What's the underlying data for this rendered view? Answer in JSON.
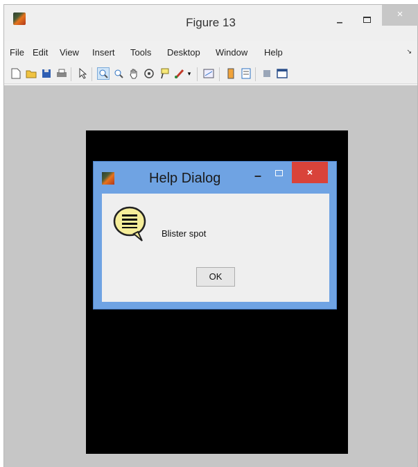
{
  "window": {
    "title": "Figure 13",
    "minimize_label": "–",
    "close_label": "×"
  },
  "menu": {
    "items": [
      "File",
      "Edit",
      "View",
      "Insert",
      "Tools",
      "Desktop",
      "Window",
      "Help"
    ],
    "overflow_label": "↘"
  },
  "toolbar": {
    "tools": [
      "new-figure-icon",
      "open-file-icon",
      "save-icon",
      "print-icon",
      "pointer-icon",
      "zoom-in-icon",
      "zoom-out-icon",
      "pan-hand-icon",
      "rotate-3d-icon",
      "data-cursor-icon",
      "brush-icon",
      "link-plot-icon",
      "colorbar-icon",
      "legend-icon",
      "hide-tools-icon",
      "show-tools-icon"
    ],
    "active_tool": "zoom-in-icon"
  },
  "dialog": {
    "title": "Help Dialog",
    "minimize_label": "–",
    "close_label": "×",
    "message": "Blister spot",
    "ok_label": "OK"
  },
  "colors": {
    "dialog_frame": "#6fa3e3",
    "close_button": "#d9433a",
    "axes_background": "#000000",
    "figure_background": "#c6c6c6"
  }
}
